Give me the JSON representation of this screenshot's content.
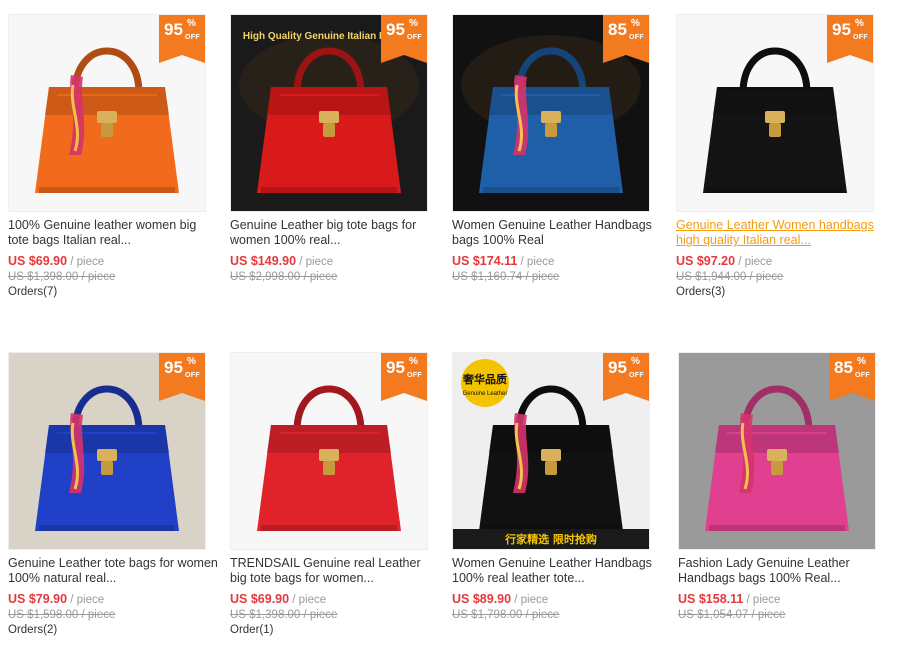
{
  "products": [
    {
      "discount": "95",
      "pct": "%",
      "off": "OFF",
      "title": "100% Genuine leather women big tote bags Italian real...",
      "price": "US $69.90",
      "unit": " / piece",
      "original": "US $1,398.00 / piece",
      "orders": "Orders(7)",
      "bag_color": "#f26a1b",
      "bg": "#f7f7f7",
      "scarf": true
    },
    {
      "discount": "95",
      "pct": "%",
      "off": "OFF",
      "title": "Genuine Leather big tote bags for women 100% real...",
      "price": "US $149.90",
      "unit": " / piece",
      "original": "US $2,998.00 / piece",
      "orders": "",
      "bag_color": "#d91a1a",
      "bg": "#1a1a1a",
      "banner": "High Quality Genuine Italian Leather"
    },
    {
      "discount": "85",
      "pct": "%",
      "off": "OFF",
      "title": "Women Genuine Leather Handbags bags 100% Real",
      "price": "US $174.11",
      "unit": " / piece",
      "original": "US $1,160.74 / piece",
      "orders": "",
      "bag_color": "#1f5fa8",
      "bg": "#111111",
      "scarf": true
    },
    {
      "discount": "95",
      "pct": "%",
      "off": "OFF",
      "title": "Genuine Leather Women handbags high quality Italian real...",
      "price": "US $97.20",
      "unit": " / piece",
      "original": "US $1,944.00 / piece",
      "orders": "Orders(3)",
      "bag_color": "#141414",
      "bg": "#f7f7f7",
      "hover": true
    },
    {
      "discount": "95",
      "pct": "%",
      "off": "OFF",
      "title": "Genuine Leather tote bags for women 100% natural real...",
      "price": "US $79.90",
      "unit": " / piece",
      "original": "US $1,598.00 / piece",
      "orders": "Orders(2)",
      "bag_color": "#2040c8",
      "bg": "#d9d2c6",
      "scarf": true
    },
    {
      "discount": "95",
      "pct": "%",
      "off": "OFF",
      "title": "TRENDSAIL Genuine real Leather big tote bags for women...",
      "price": "US $69.90",
      "unit": " / piece",
      "original": "US $1,398.00 / piece",
      "orders": "Order(1)",
      "bag_color": "#e0232b",
      "bg": "#f7f7f7"
    },
    {
      "discount": "95",
      "pct": "%",
      "off": "OFF",
      "title": "Women Genuine Leather Handbags 100% real leather tote...",
      "price": "US $89.90",
      "unit": " / piece",
      "original": "US $1,798.00 / piece",
      "orders": "",
      "bag_color": "#111111",
      "bg": "#efefef",
      "scarf": true,
      "stamp": "奢华品质",
      "stamp_sub": "Genuine Leather",
      "promo": "行家精选 限时抢购"
    },
    {
      "discount": "85",
      "pct": "%",
      "off": "OFF",
      "title": "Fashion Lady Genuine Leather Handbags bags 100% Real...",
      "price": "US $158.11",
      "unit": " / piece",
      "original": "US $1,054.07 / piece",
      "orders": "",
      "bag_color": "#e0408f",
      "bg": "#9a9a9a",
      "scarf": true
    }
  ]
}
